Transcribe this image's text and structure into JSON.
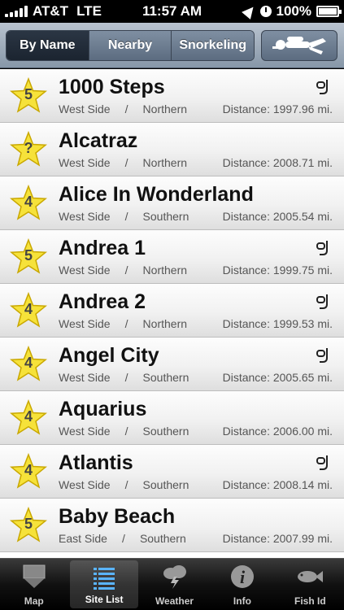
{
  "status_bar": {
    "carrier": "AT&T",
    "network": "LTE",
    "time": "11:57 AM",
    "battery": "100%"
  },
  "toolbar": {
    "segments": [
      "By Name",
      "Nearby",
      "Snorkeling"
    ],
    "active_segment": "By Name",
    "diver_icon": "diver-icon"
  },
  "sites": [
    {
      "rating": "5",
      "name": "1000 Steps",
      "side": "West Side",
      "separator": "/",
      "region": "Northern",
      "distance": "Distance: 1997.96 mi.",
      "snorkel": true
    },
    {
      "rating": "?",
      "name": "Alcatraz",
      "side": "West Side",
      "separator": "/",
      "region": "Northern",
      "distance": "Distance: 2008.71 mi.",
      "snorkel": false
    },
    {
      "rating": "4",
      "name": "Alice In Wonderland",
      "side": "West Side",
      "separator": "/",
      "region": "Southern",
      "distance": "Distance: 2005.54 mi.",
      "snorkel": false
    },
    {
      "rating": "5",
      "name": "Andrea 1",
      "side": "West Side",
      "separator": "/",
      "region": "Northern",
      "distance": "Distance: 1999.75 mi.",
      "snorkel": true
    },
    {
      "rating": "4",
      "name": "Andrea 2",
      "side": "West Side",
      "separator": "/",
      "region": "Northern",
      "distance": "Distance: 1999.53 mi.",
      "snorkel": true
    },
    {
      "rating": "4",
      "name": "Angel City",
      "side": "West Side",
      "separator": "/",
      "region": "Southern",
      "distance": "Distance: 2005.65 mi.",
      "snorkel": true
    },
    {
      "rating": "4",
      "name": "Aquarius",
      "side": "West Side",
      "separator": "/",
      "region": "Southern",
      "distance": "Distance: 2006.00 mi.",
      "snorkel": false
    },
    {
      "rating": "4",
      "name": "Atlantis",
      "side": "West Side",
      "separator": "/",
      "region": "Southern",
      "distance": "Distance: 2008.14 mi.",
      "snorkel": true
    },
    {
      "rating": "5",
      "name": "Baby Beach",
      "side": "East Side",
      "separator": "/",
      "region": "Southern",
      "distance": "Distance: 2007.99 mi.",
      "snorkel": false
    }
  ],
  "tabs": [
    {
      "label": "Map",
      "icon": "map-pin-icon",
      "active": false
    },
    {
      "label": "Site List",
      "icon": "list-icon",
      "active": true
    },
    {
      "label": "Weather",
      "icon": "storm-cloud-icon",
      "active": false
    },
    {
      "label": "Info",
      "icon": "info-icon",
      "active": false
    },
    {
      "label": "Fish Id",
      "icon": "fish-icon",
      "active": false
    }
  ],
  "colors": {
    "star_fill": "#f6e23a",
    "toolbar_top": "#b9c3cf",
    "segment_active": "#1b2430"
  }
}
